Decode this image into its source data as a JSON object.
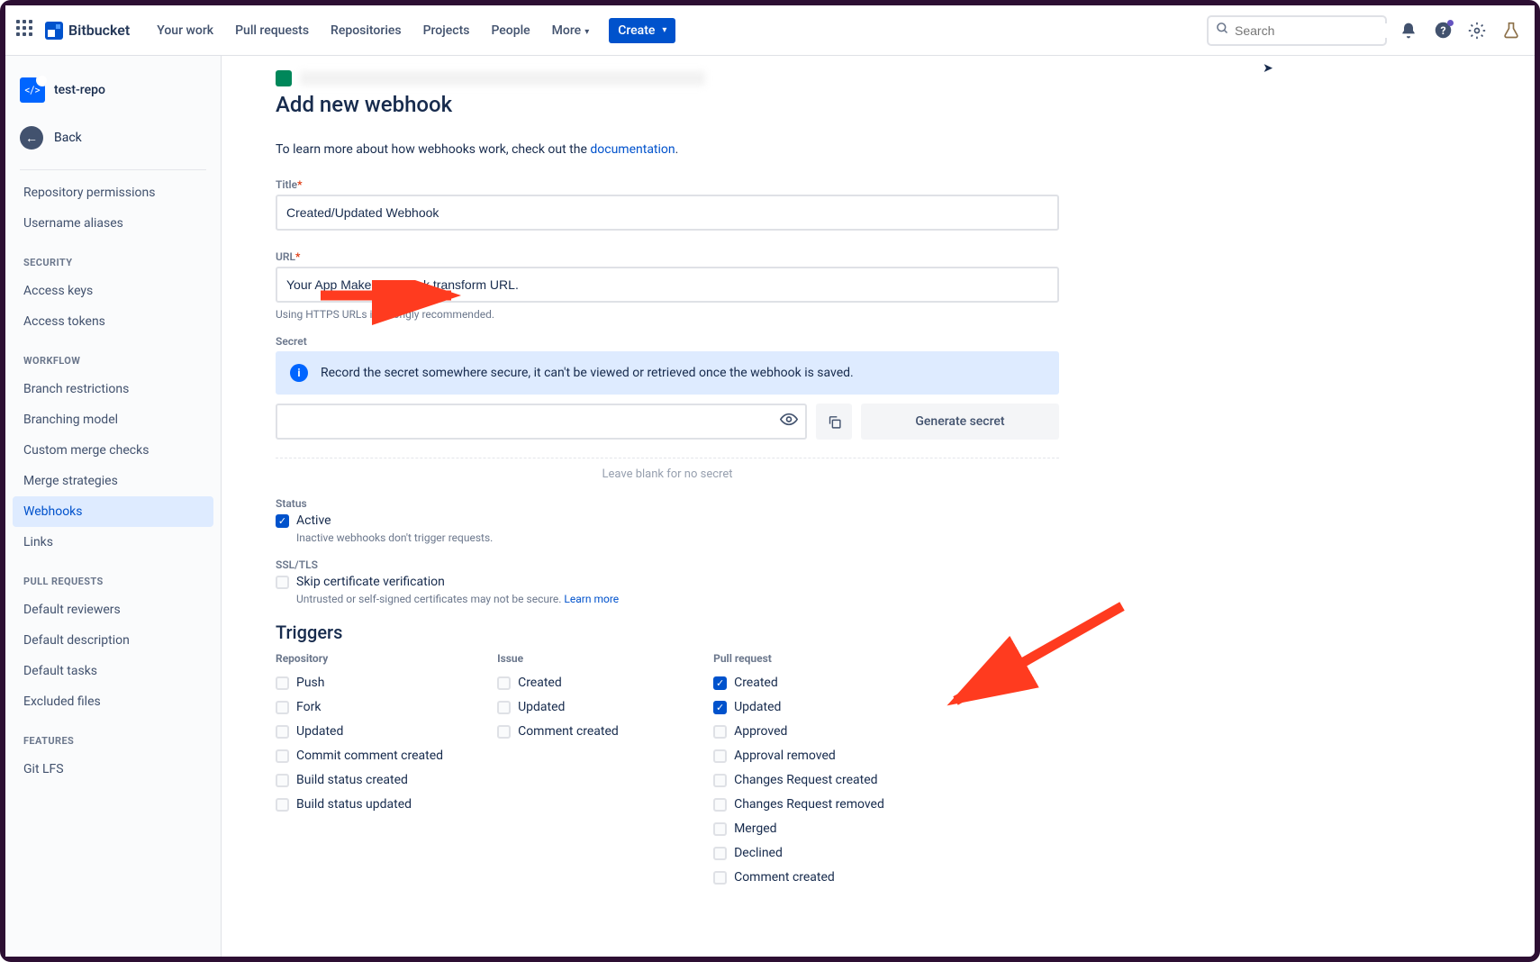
{
  "topbar": {
    "product": "Bitbucket",
    "nav": [
      "Your work",
      "Pull requests",
      "Repositories",
      "Projects",
      "People",
      "More"
    ],
    "create": "Create",
    "search_placeholder": "Search"
  },
  "sidebar": {
    "repo": "test-repo",
    "back": "Back",
    "top_items": [
      "Repository permissions",
      "Username aliases"
    ],
    "sections": [
      {
        "title": "SECURITY",
        "items": [
          "Access keys",
          "Access tokens"
        ]
      },
      {
        "title": "WORKFLOW",
        "items": [
          "Branch restrictions",
          "Branching model",
          "Custom merge checks",
          "Merge strategies",
          "Webhooks",
          "Links"
        ],
        "active": "Webhooks"
      },
      {
        "title": "PULL REQUESTS",
        "items": [
          "Default reviewers",
          "Default description",
          "Default tasks",
          "Excluded files"
        ]
      },
      {
        "title": "FEATURES",
        "items": [
          "Git LFS"
        ]
      }
    ]
  },
  "page": {
    "title": "Add new webhook",
    "intro_prefix": "To learn more about how webhooks work, check out the ",
    "intro_link": "documentation",
    "labels": {
      "title": "Title",
      "url": "URL",
      "secret": "Secret",
      "status": "Status",
      "ssl": "SSL/TLS"
    },
    "fields": {
      "title_value": "Created/Updated Webhook",
      "url_value": "Your App Maker webhook transform URL.",
      "url_hint": "Using HTTPS URLs is strongly recommended."
    },
    "secret": {
      "banner": "Record the secret somewhere secure, it can't be viewed or retrieved once the webhook is saved.",
      "generate": "Generate secret",
      "blank_hint": "Leave blank for no secret"
    },
    "status": {
      "active": "Active",
      "active_hint": "Inactive webhooks don't trigger requests."
    },
    "ssl": {
      "skip": "Skip certificate verification",
      "hint_text": "Untrusted or self-signed certificates may not be secure. ",
      "learn_more": "Learn more"
    },
    "triggers": {
      "heading": "Triggers",
      "columns": [
        {
          "title": "Repository",
          "items": [
            {
              "label": "Push",
              "checked": false
            },
            {
              "label": "Fork",
              "checked": false
            },
            {
              "label": "Updated",
              "checked": false
            },
            {
              "label": "Commit comment created",
              "checked": false
            },
            {
              "label": "Build status created",
              "checked": false
            },
            {
              "label": "Build status updated",
              "checked": false
            }
          ]
        },
        {
          "title": "Issue",
          "items": [
            {
              "label": "Created",
              "checked": false
            },
            {
              "label": "Updated",
              "checked": false
            },
            {
              "label": "Comment created",
              "checked": false
            }
          ]
        },
        {
          "title": "Pull request",
          "items": [
            {
              "label": "Created",
              "checked": true
            },
            {
              "label": "Updated",
              "checked": true
            },
            {
              "label": "Approved",
              "checked": false
            },
            {
              "label": "Approval removed",
              "checked": false
            },
            {
              "label": "Changes Request created",
              "checked": false
            },
            {
              "label": "Changes Request removed",
              "checked": false
            },
            {
              "label": "Merged",
              "checked": false
            },
            {
              "label": "Declined",
              "checked": false
            },
            {
              "label": "Comment created",
              "checked": false
            }
          ]
        }
      ]
    }
  }
}
